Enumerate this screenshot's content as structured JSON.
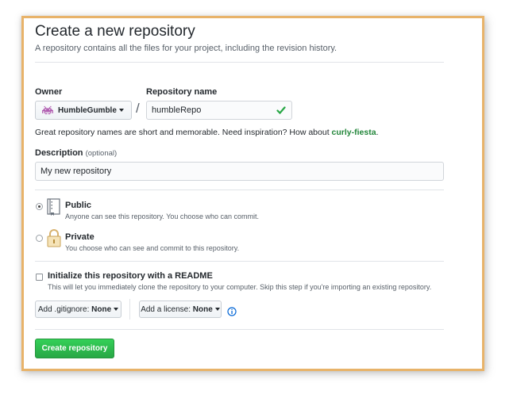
{
  "header": {
    "title": "Create a new repository",
    "subtitle": "A repository contains all the files for your project, including the revision history."
  },
  "owner": {
    "label": "Owner",
    "value": "HumbleGumble",
    "avatar_icon": "space-invader-icon"
  },
  "repo_name": {
    "label": "Repository name",
    "value": "humbleRepo",
    "separator": "/",
    "valid_icon": "checkmark-icon"
  },
  "hint": {
    "text": "Great repository names are short and memorable. Need inspiration? How about ",
    "suggestion": "curly-fiesta",
    "end": "."
  },
  "description": {
    "label": "Description",
    "optional": "(optional)",
    "value": "My new repository"
  },
  "visibility": {
    "public": {
      "label": "Public",
      "desc": "Anyone can see this repository. You choose who can commit.",
      "selected": true,
      "icon": "repo-book-icon"
    },
    "private": {
      "label": "Private",
      "desc": "You choose who can see and commit to this repository.",
      "selected": false,
      "icon": "lock-icon"
    }
  },
  "readme": {
    "label": "Initialize this repository with a README",
    "desc": "This will let you immediately clone the repository to your computer. Skip this step if you're importing an existing repository.",
    "checked": false
  },
  "gitignore": {
    "prefix": "Add .gitignore:",
    "value": "None"
  },
  "license": {
    "prefix": "Add a license:",
    "value": "None",
    "info_icon": "info-icon"
  },
  "submit": {
    "label": "Create repository"
  },
  "colors": {
    "accent_green": "#28a745",
    "frame_border": "#e8b36a",
    "suggestion": "#22863a",
    "info_blue": "#0366d6"
  }
}
